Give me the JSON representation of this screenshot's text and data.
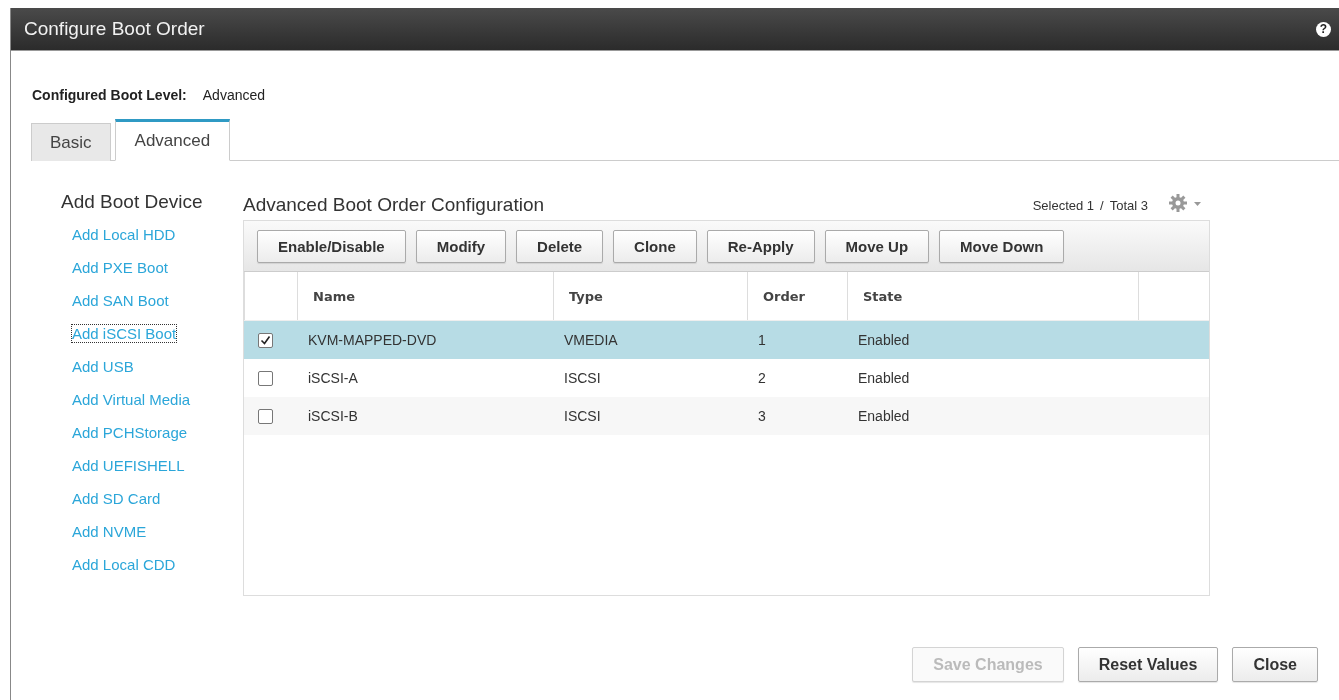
{
  "window": {
    "title": "Configure Boot Order",
    "help": "?"
  },
  "boot_level": {
    "label": "Configured Boot Level:",
    "value": "Advanced"
  },
  "tabs": [
    {
      "label": "Basic",
      "selected": false
    },
    {
      "label": "Advanced",
      "selected": true
    }
  ],
  "sidebar": {
    "title": "Add Boot Device",
    "items": [
      {
        "label": "Add Local HDD",
        "focused": false
      },
      {
        "label": "Add PXE Boot",
        "focused": false
      },
      {
        "label": "Add SAN Boot",
        "focused": false
      },
      {
        "label": "Add iSCSI Boot",
        "focused": true
      },
      {
        "label": "Add USB",
        "focused": false
      },
      {
        "label": "Add Virtual Media",
        "focused": false
      },
      {
        "label": "Add PCHStorage",
        "focused": false
      },
      {
        "label": "Add UEFISHELL",
        "focused": false
      },
      {
        "label": "Add SD Card",
        "focused": false
      },
      {
        "label": "Add NVME",
        "focused": false
      },
      {
        "label": "Add Local CDD",
        "focused": false
      }
    ]
  },
  "panel": {
    "title": "Advanced Boot Order Configuration",
    "selection_count": "Selected 1",
    "separator": "/",
    "total_count": "Total 3",
    "toolbar": [
      "Enable/Disable",
      "Modify",
      "Delete",
      "Clone",
      "Re-Apply",
      "Move Up",
      "Move Down"
    ],
    "table": {
      "columns": [
        "Name",
        "Type",
        "Order",
        "State"
      ],
      "rows": [
        {
          "checked": true,
          "selected": true,
          "cells": [
            "KVM-MAPPED-DVD",
            "VMEDIA",
            "1",
            "Enabled"
          ]
        },
        {
          "checked": false,
          "selected": false,
          "cells": [
            "iSCSI-A",
            "ISCSI",
            "2",
            "Enabled"
          ]
        },
        {
          "checked": false,
          "selected": false,
          "cells": [
            "iSCSI-B",
            "ISCSI",
            "3",
            "Enabled"
          ]
        }
      ]
    }
  },
  "footer_buttons": [
    {
      "label": "Save Changes",
      "disabled": true
    },
    {
      "label": "Reset Values",
      "disabled": false
    },
    {
      "label": "Close",
      "disabled": false
    }
  ]
}
